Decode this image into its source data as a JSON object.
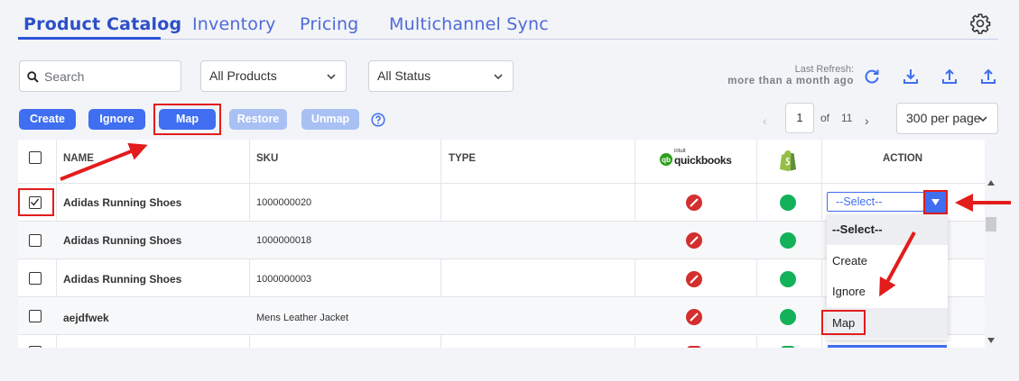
{
  "tabs": [
    {
      "label": "Product Catalog",
      "active": true
    },
    {
      "label": "Inventory",
      "active": false
    },
    {
      "label": "Pricing",
      "active": false
    },
    {
      "label": "Multichannel Sync",
      "active": false
    }
  ],
  "filters": {
    "search_placeholder": "Search",
    "products_filter": "All Products",
    "status_filter": "All Status"
  },
  "refresh": {
    "label": "Last Refresh:",
    "value": "more than a month ago"
  },
  "toolbar": {
    "create": "Create",
    "ignore": "Ignore",
    "map": "Map",
    "restore": "Restore",
    "unmap": "Unmap"
  },
  "pagination": {
    "current": "1",
    "of": "of",
    "total": "11",
    "per_page": "300 per page"
  },
  "table": {
    "headers": {
      "name": "NAME",
      "sku": "SKU",
      "type": "TYPE",
      "quickbooks_brand": "quickbooks",
      "quickbooks_small": "intuit",
      "action": "ACTION"
    },
    "rows": [
      {
        "name": "Adidas Running Shoes",
        "sku": "1000000020",
        "type": "",
        "checked": true
      },
      {
        "name": "Adidas Running Shoes",
        "sku": "1000000018",
        "type": "",
        "checked": false
      },
      {
        "name": "Adidas Running Shoes",
        "sku": "1000000003",
        "type": "",
        "checked": false
      },
      {
        "name": "aejdfwek",
        "sku": "Mens Leather Jacket",
        "type": "",
        "checked": false
      }
    ]
  },
  "action_dropdown": {
    "selected": "--Select--",
    "options": [
      "--Select--",
      "Create",
      "Ignore",
      "Map"
    ]
  },
  "colors": {
    "accent": "#3f6ef0",
    "highlight": "#e31c1c",
    "status_green": "#12b15a",
    "status_red": "#d32f2f"
  }
}
